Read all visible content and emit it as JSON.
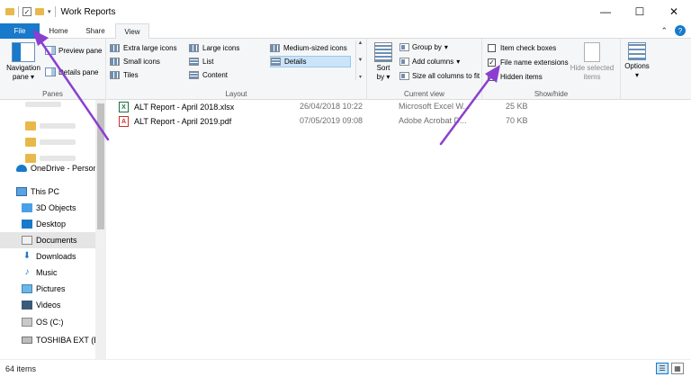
{
  "window": {
    "title": "Work Reports",
    "controls": {
      "minimize": "—",
      "maximize": "☐",
      "close": "✕"
    }
  },
  "tabs": {
    "file": "File",
    "home": "Home",
    "share": "Share",
    "view": "View"
  },
  "ribbon": {
    "panes": {
      "label": "Panes",
      "navigation_pane": "Navigation pane",
      "preview_pane": "Preview pane",
      "details_pane": "Details pane"
    },
    "layout": {
      "label": "Layout",
      "items": {
        "extra_large": "Extra large icons",
        "large": "Large icons",
        "medium": "Medium-sized icons",
        "small": "Small icons",
        "list": "List",
        "details": "Details",
        "tiles": "Tiles",
        "content": "Content"
      },
      "selected": "Details"
    },
    "current_view": {
      "label": "Current view",
      "sort_by": "Sort by",
      "group_by": "Group by",
      "add_columns": "Add columns",
      "size_all": "Size all columns to fit"
    },
    "show_hide": {
      "label": "Show/hide",
      "item_check_boxes": {
        "text": "Item check boxes",
        "checked": false
      },
      "file_name_extensions": {
        "text": "File name extensions",
        "checked": true
      },
      "hidden_items": {
        "text": "Hidden items",
        "checked": false
      },
      "hide_selected": "Hide selected items"
    },
    "options": "Options"
  },
  "nav": {
    "items": [
      {
        "label": "OneDrive - Person",
        "icon": "cloud-icon"
      },
      {
        "label": "This PC",
        "icon": "computer-icon"
      },
      {
        "label": "3D Objects",
        "icon": "3d-objects-icon"
      },
      {
        "label": "Desktop",
        "icon": "desktop-icon"
      },
      {
        "label": "Documents",
        "icon": "documents-icon",
        "selected": true
      },
      {
        "label": "Downloads",
        "icon": "download-icon"
      },
      {
        "label": "Music",
        "icon": "music-icon"
      },
      {
        "label": "Pictures",
        "icon": "pictures-icon"
      },
      {
        "label": "Videos",
        "icon": "videos-icon"
      },
      {
        "label": "OS (C:)",
        "icon": "drive-icon"
      },
      {
        "label": "TOSHIBA EXT (E",
        "icon": "usb-drive-icon"
      }
    ]
  },
  "files": [
    {
      "name": "ALT Report - April 2018.xlsx",
      "date": "26/04/2018 10:22",
      "type": "Microsoft Excel W...",
      "size": "25 KB",
      "icon_char": "X"
    },
    {
      "name": "ALT Report - April 2019.pdf",
      "date": "07/05/2019 09:08",
      "type": "Adobe Acrobat D...",
      "size": "70 KB",
      "icon_char": "A"
    }
  ],
  "status": {
    "item_count": "64 items"
  },
  "colors": {
    "accent": "#1979ca",
    "annotation": "#8a3fd1"
  }
}
